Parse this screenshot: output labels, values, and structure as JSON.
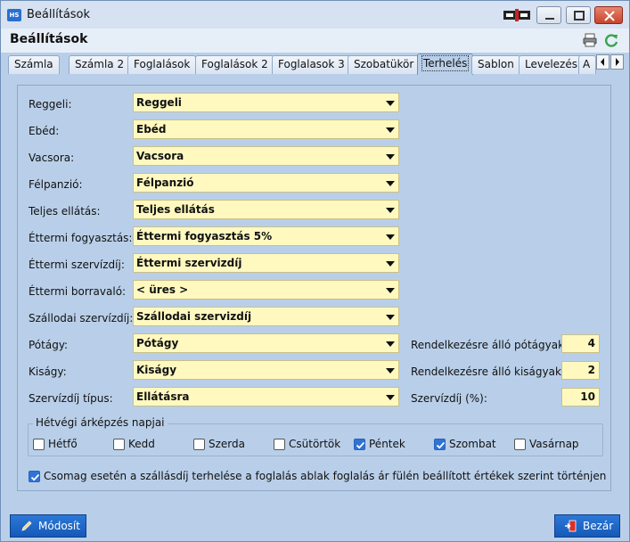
{
  "window": {
    "title": "Beállítások",
    "app_icon_text": "HS"
  },
  "header": {
    "title": "Beállítások",
    "icons": [
      "printer-icon",
      "refresh-icon"
    ]
  },
  "tabs": [
    {
      "label": "Számla",
      "active": false
    },
    {
      "label": "Számla 2",
      "active": false
    },
    {
      "label": "Foglalások",
      "active": false
    },
    {
      "label": "Foglalások 2",
      "active": false
    },
    {
      "label": "Foglalasok 3",
      "active": false
    },
    {
      "label": "Szobatükör",
      "active": false
    },
    {
      "label": "Terhelés",
      "active": true
    },
    {
      "label": "Sablon",
      "active": false
    },
    {
      "label": "Levelezés",
      "active": false
    },
    {
      "label": "A",
      "active": false
    }
  ],
  "form": {
    "fields": [
      {
        "label": "Reggeli:",
        "value": "Reggeli"
      },
      {
        "label": "Ebéd:",
        "value": "Ebéd"
      },
      {
        "label": "Vacsora:",
        "value": "Vacsora"
      },
      {
        "label": "Félpanzió:",
        "value": "Félpanzió"
      },
      {
        "label": "Teljes ellátás:",
        "value": "Teljes ellátás"
      },
      {
        "label": "Éttermi fogyasztás:",
        "value": "Éttermi fogyasztás 5%"
      },
      {
        "label": "Éttermi szervízdíj:",
        "value": "Éttermi szervizdíj"
      },
      {
        "label": "Éttermi borravaló:",
        "value": "< üres >"
      },
      {
        "label": "Szállodai szervízdíj:",
        "value": "Szállodai szervizdíj"
      },
      {
        "label": "Pótágy:",
        "value": "Pótágy"
      },
      {
        "label": "Kiságy:",
        "value": "Kiságy"
      },
      {
        "label": "Szervízdíj típus:",
        "value": "Ellátásra"
      }
    ],
    "right_fields": [
      {
        "label": "Rendelkezésre álló pótágyak:",
        "value": "4"
      },
      {
        "label": "Rendelkezésre álló kiságyak:",
        "value": "2"
      },
      {
        "label": "Szervízdíj (%):",
        "value": "10"
      }
    ]
  },
  "weekend": {
    "title": "Hétvégi árképzés napjai",
    "days": [
      {
        "label": "Hétfő",
        "checked": false
      },
      {
        "label": "Kedd",
        "checked": false
      },
      {
        "label": "Szerda",
        "checked": false
      },
      {
        "label": "Csütörtök",
        "checked": false
      },
      {
        "label": "Péntek",
        "checked": true
      },
      {
        "label": "Szombat",
        "checked": true
      },
      {
        "label": "Vasárnap",
        "checked": false
      }
    ]
  },
  "package_option": {
    "label": "Csomag esetén a szállásdíj terhelése a foglalás ablak foglalás ár fülén beállított értékek szerint történjen",
    "checked": true
  },
  "footer": {
    "modify_label": "Módosít",
    "close_label": "Bezár"
  },
  "colors": {
    "field_bg": "#fff9c0",
    "panel_bg": "#b9cfe9",
    "button_blue": "#1f66c6",
    "checkbox_blue": "#2f73d8"
  }
}
